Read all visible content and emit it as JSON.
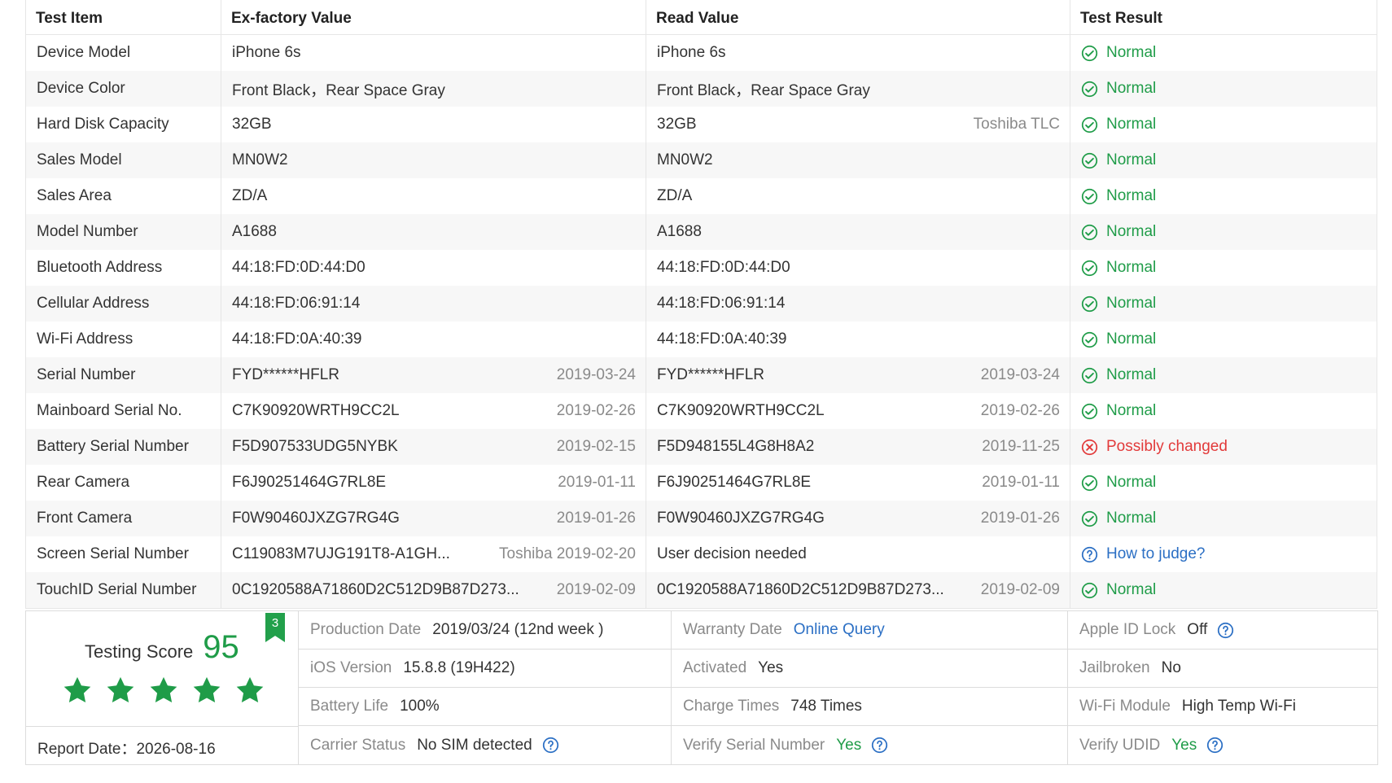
{
  "table": {
    "headers": [
      "Test Item",
      "Ex-factory Value",
      "Read Value",
      "Test Result"
    ],
    "rows": [
      {
        "item": "Device Model",
        "ex_value": "iPhone 6s",
        "ex_date": "",
        "read_value": "iPhone 6s",
        "read_date": "",
        "result": "Normal",
        "status": "ok"
      },
      {
        "item": "Device Color",
        "ex_value": "Front Black，Rear Space Gray",
        "ex_date": "",
        "read_value": "Front Black，Rear Space Gray",
        "read_date": "",
        "result": "Normal",
        "status": "ok"
      },
      {
        "item": "Hard Disk Capacity",
        "ex_value": "32GB",
        "ex_date": "",
        "read_value": "32GB",
        "read_date": "Toshiba TLC",
        "result": "Normal",
        "status": "ok"
      },
      {
        "item": "Sales Model",
        "ex_value": "MN0W2",
        "ex_date": "",
        "read_value": "MN0W2",
        "read_date": "",
        "result": "Normal",
        "status": "ok"
      },
      {
        "item": "Sales Area",
        "ex_value": "ZD/A",
        "ex_date": "",
        "read_value": "ZD/A",
        "read_date": "",
        "result": "Normal",
        "status": "ok"
      },
      {
        "item": "Model Number",
        "ex_value": "A1688",
        "ex_date": "",
        "read_value": "A1688",
        "read_date": "",
        "result": "Normal",
        "status": "ok"
      },
      {
        "item": "Bluetooth Address",
        "ex_value": "44:18:FD:0D:44:D0",
        "ex_date": "",
        "read_value": "44:18:FD:0D:44:D0",
        "read_date": "",
        "result": "Normal",
        "status": "ok"
      },
      {
        "item": "Cellular Address",
        "ex_value": "44:18:FD:06:91:14",
        "ex_date": "",
        "read_value": "44:18:FD:06:91:14",
        "read_date": "",
        "result": "Normal",
        "status": "ok"
      },
      {
        "item": "Wi-Fi Address",
        "ex_value": "44:18:FD:0A:40:39",
        "ex_date": "",
        "read_value": "44:18:FD:0A:40:39",
        "read_date": "",
        "result": "Normal",
        "status": "ok"
      },
      {
        "item": "Serial Number",
        "ex_value": "FYD******HFLR",
        "ex_date": "2019-03-24",
        "read_value": "FYD******HFLR",
        "read_date": "2019-03-24",
        "result": "Normal",
        "status": "ok"
      },
      {
        "item": "Mainboard Serial No.",
        "ex_value": "C7K90920WRTH9CC2L",
        "ex_date": "2019-02-26",
        "read_value": "C7K90920WRTH9CC2L",
        "read_date": "2019-02-26",
        "result": "Normal",
        "status": "ok"
      },
      {
        "item": "Battery Serial Number",
        "ex_value": "F5D907533UDG5NYBK",
        "ex_date": "2019-02-15",
        "read_value": "F5D948155L4G8H8A2",
        "read_date": "2019-11-25",
        "result": "Possibly changed",
        "status": "bad"
      },
      {
        "item": "Rear Camera",
        "ex_value": "F6J90251464G7RL8E",
        "ex_date": "2019-01-11",
        "read_value": "F6J90251464G7RL8E",
        "read_date": "2019-01-11",
        "result": "Normal",
        "status": "ok"
      },
      {
        "item": "Front Camera",
        "ex_value": "F0W90460JXZG7RG4G",
        "ex_date": "2019-01-26",
        "read_value": "F0W90460JXZG7RG4G",
        "read_date": "2019-01-26",
        "result": "Normal",
        "status": "ok"
      },
      {
        "item": "Screen Serial Number",
        "ex_value": "C119083M7UJG191T8-A1GH...",
        "ex_date": "Toshiba 2019-02-20",
        "read_value": "User decision needed",
        "read_date": "",
        "result": "How to judge?",
        "status": "ask"
      },
      {
        "item": "TouchID Serial Number",
        "ex_value": "0C1920588A71860D2C512D9B87D273...",
        "ex_date": "2019-02-09",
        "read_value": "0C1920588A71860D2C512D9B87D273...",
        "read_date": "2019-02-09",
        "result": "Normal",
        "status": "ok"
      }
    ]
  },
  "summary": {
    "score_label": "Testing Score",
    "score_value": "95",
    "stars": 5,
    "badge": "3",
    "report_date": "Report Date：2026-08-16",
    "info": [
      [
        {
          "label": "Production Date",
          "value": "2019/03/24 (12nd week )",
          "style": "plain",
          "help": false
        },
        {
          "label": "Warranty Date",
          "value": "Online Query",
          "style": "link",
          "help": false
        },
        {
          "label": "Apple ID Lock",
          "value": "Off",
          "style": "plain",
          "help": true
        }
      ],
      [
        {
          "label": "iOS Version",
          "value": "15.8.8 (19H422)",
          "style": "plain",
          "help": false
        },
        {
          "label": "Activated",
          "value": "Yes",
          "style": "plain",
          "help": false
        },
        {
          "label": "Jailbroken",
          "value": "No",
          "style": "plain",
          "help": false
        }
      ],
      [
        {
          "label": "Battery Life",
          "value": "100%",
          "style": "plain",
          "help": false
        },
        {
          "label": "Charge Times",
          "value": "748 Times",
          "style": "plain",
          "help": false
        },
        {
          "label": "Wi-Fi Module",
          "value": "High Temp Wi-Fi",
          "style": "plain",
          "help": false
        }
      ],
      [
        {
          "label": "Carrier Status",
          "value": "No SIM detected",
          "style": "plain",
          "help": true
        },
        {
          "label": "Verify Serial Number",
          "value": "Yes",
          "style": "green",
          "help": true
        },
        {
          "label": "Verify UDID",
          "value": "Yes",
          "style": "green",
          "help": true
        }
      ]
    ]
  },
  "colors": {
    "ok": "#1f9c48",
    "bad": "#e23a3a",
    "ask": "#2b6fc4",
    "star": "#1f9c48"
  },
  "icons": {
    "ok": "check-circle-icon",
    "bad": "x-circle-icon",
    "ask": "question-circle-icon",
    "star": "star-icon",
    "help": "question-circle-icon"
  }
}
